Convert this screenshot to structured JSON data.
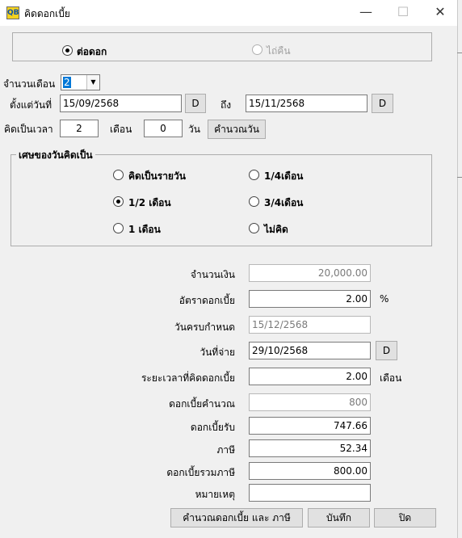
{
  "window": {
    "title": "คิดดอกเบี้ย",
    "icon_text": "QB",
    "minimize_symbol": "—",
    "maximize_symbol": "☐",
    "close_symbol": "✕"
  },
  "mode": {
    "options": [
      {
        "label": "ต่อดอก",
        "checked": true,
        "enabled": true
      },
      {
        "label": "ไถ่คืน",
        "checked": false,
        "enabled": false
      }
    ]
  },
  "period": {
    "months_label": "จำนวนเดือน",
    "months_value": "2",
    "from_label": "ตั้งแต่วันที่",
    "from_value": "15/09/2568",
    "date_button": "D",
    "to_label": "ถึง",
    "to_value": "15/11/2568",
    "calc_as_label": "คิดเป็นเวลา",
    "calc_months": "2",
    "month_unit": "เดือน",
    "calc_days": "0",
    "day_unit": "วัน",
    "calc_days_button": "คำนวณวัน"
  },
  "remainder": {
    "title": "เศษของวันคิดเป็น",
    "options": [
      {
        "label": "คิดเป็นรายวัน",
        "checked": false
      },
      {
        "label": "1/4เดือน",
        "checked": false
      },
      {
        "label": "1/2 เดือน",
        "checked": true
      },
      {
        "label": "3/4เดือน",
        "checked": false
      },
      {
        "label": "1 เดือน",
        "checked": false
      },
      {
        "label": "ไม่คิด",
        "checked": false
      }
    ]
  },
  "form": {
    "amount_label": "จำนวนเงิน",
    "amount_value": "20,000.00",
    "rate_label": "อัตราดอกเบี้ย",
    "rate_value": "2.00",
    "rate_unit": "%",
    "due_label": "วันครบกำหนด",
    "due_value": "15/12/2568",
    "pay_date_label": "วันที่จ่าย",
    "pay_date_value": "29/10/2568",
    "date_button": "D",
    "period_label": "ระยะเวลาที่คิดดอกเบี้ย",
    "period_value": "2.00",
    "period_unit": "เดือน",
    "calc_interest_label": "ดอกเบี้ยคำนวณ",
    "calc_interest_value": "800",
    "received_label": "ดอกเบี้ยรับ",
    "received_value": "747.66",
    "tax_label": "ภาษี",
    "tax_value": "52.34",
    "total_label": "ดอกเบี้ยรวมภาษี",
    "total_value": "800.00",
    "note_label": "หมายเหตุ",
    "note_value": ""
  },
  "buttons": {
    "calculate": "คำนวณดอกเบี้ย และ ภาษี",
    "save": "บันทึก",
    "close": "ปิด"
  }
}
